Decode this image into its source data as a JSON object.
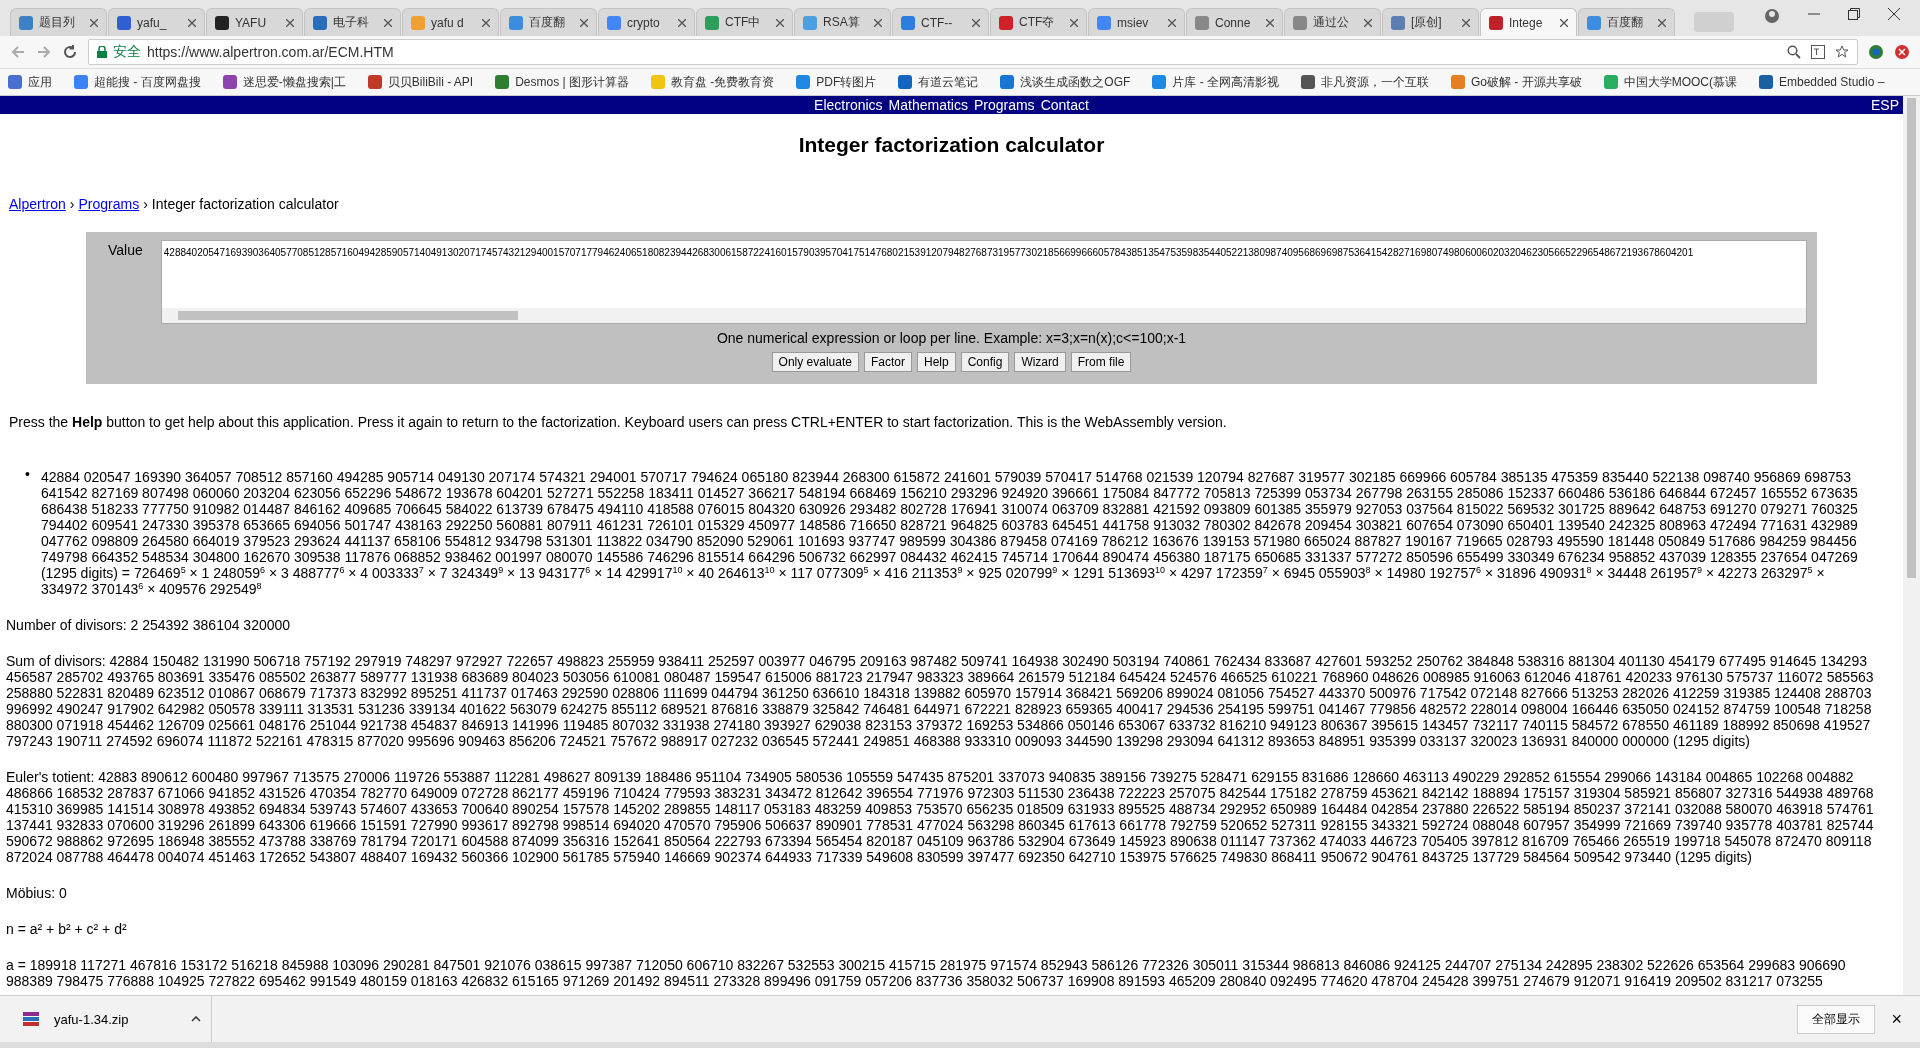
{
  "browser": {
    "tabs": [
      {
        "label": "题目列",
        "selected": false,
        "color": "#3b82c4"
      },
      {
        "label": "yafu_",
        "selected": false,
        "color": "#2f5fd0"
      },
      {
        "label": "YAFU",
        "selected": false,
        "color": "#222222"
      },
      {
        "label": "电子科",
        "selected": false,
        "color": "#2a6ebb"
      },
      {
        "label": "yafu d",
        "selected": false,
        "color": "#f0a030"
      },
      {
        "label": "百度翻",
        "selected": false,
        "color": "#3c8dde"
      },
      {
        "label": "crypto",
        "selected": false,
        "color": "#4285f4"
      },
      {
        "label": "CTF中",
        "selected": false,
        "color": "#2e9e5b"
      },
      {
        "label": "RSA算",
        "selected": false,
        "color": "#4aa0e0"
      },
      {
        "label": "CTF--",
        "selected": false,
        "color": "#2d7de0"
      },
      {
        "label": "CTF夺",
        "selected": false,
        "color": "#d0202a"
      },
      {
        "label": "msiev",
        "selected": false,
        "color": "#4285f4"
      },
      {
        "label": "Conne",
        "selected": false,
        "color": "#888888"
      },
      {
        "label": "通过公",
        "selected": false,
        "color": "#888888"
      },
      {
        "label": "[原创]",
        "selected": false,
        "color": "#5b7fb0"
      },
      {
        "label": "Intege",
        "selected": true,
        "color": "#c0202a"
      },
      {
        "label": "百度翻",
        "selected": false,
        "color": "#3c8dde"
      }
    ],
    "secure_label": "安全",
    "url": "https://www.alpertron.com.ar/ECM.HTM",
    "bookmarks": [
      {
        "label": "应用",
        "color": "#4a6fd0"
      },
      {
        "label": "超能搜 - 百度网盘搜",
        "color": "#3b82f6"
      },
      {
        "label": "迷思爱-懒盘搜索|工",
        "color": "#8e44ad"
      },
      {
        "label": "贝贝BiliBili - API",
        "color": "#c0392b"
      },
      {
        "label": "Desmos | 图形计算器",
        "color": "#2e7d32"
      },
      {
        "label": "教育盘 -免费教育资",
        "color": "#f1c40f"
      },
      {
        "label": "PDF转图片",
        "color": "#1e88e5"
      },
      {
        "label": "有道云笔记",
        "color": "#1565c0"
      },
      {
        "label": "浅谈生成函数之OGF",
        "color": "#1976d2"
      },
      {
        "label": "片库 - 全网高清影视",
        "color": "#1e88e5"
      },
      {
        "label": "非凡资源，一个互联",
        "color": "#555555"
      },
      {
        "label": "Go破解 - 开源共享破",
        "color": "#e67e22"
      },
      {
        "label": "中国大学MOOC(慕课",
        "color": "#27ae60"
      },
      {
        "label": "Embedded Studio –",
        "color": "#1a5fa0"
      }
    ]
  },
  "nav": {
    "links": [
      "Electronics",
      "Mathematics",
      "Programs",
      "Contact"
    ],
    "language": "ESP"
  },
  "title": "Integer factorization calculator",
  "breadcrumb": {
    "links": [
      "Alpertron",
      "Programs"
    ],
    "separator": "›",
    "current": "Integer factorization calculator"
  },
  "list_marker": "•",
  "calculator": {
    "value_label": "Value",
    "value": "42884020547169390364057708512857160494285905714049130207174574321294001570717794624065180823944268300615872241601579039570417514768021539120794827687319577302185669966605784385135475359835440522138098740956869698753641542827169807498060060203204623056652296548672193678604201",
    "hint": "One numerical expression or loop per line. Example: x=3;x=n(x);c<=100;x-1",
    "buttons": [
      "Only evaluate",
      "Factor",
      "Help",
      "Config",
      "Wizard",
      "From file"
    ]
  },
  "help_text": "Press the **Help** button to get help about this application. Press it again to return to the factorization. Keyboard users can press CTRL+ENTER to start factorization. This is the WebAssembly version.",
  "factorization": "42884 020547 169390 364057 708512 857160 494285 905714 049130 207174 574321 294001 570717 794624 065180 823944 268300 615872 241601 579039 570417 514768 021539 120794 827687 319577 302185 669966 605784 385135 475359 835440 522138 098740 956869 698753 641542 827169 807498 060060 203204 623056 652296 548672 193678 604201 527271 552258 183411 014527 366217 548194 668469 156210 293296 924920 396661 175084 847772 705813 725399 053734 267798 263155 285086 152337 660486 536186 646844 672457 165552 673635 686438 518233 777750 910982 014487 846162 409685 706645 584022 613739 678475 494110 418588 076015 804320 630926 293482 802728 176941 310074 063709 832881 421592 093809 601385 355979 927053 037564 815022 569532 301725 889642 648753 691270 079271 760325 794402 609541 247330 395378 653665 694056 501747 438163 292250 560881 807911 461231 726101 015329 450977 148586 716650 828721 964825 603783 645451 441758 913032 780302 842678 209454 303821 607654 073090 650401 139540 242325 808963 472494 771631 432989 047762 098809 264580 664019 379523 293624 441137 658106 554812 934798 531301 113822 034790 852090 529061 101693 937747 989599 304386 879458 074169 786212 163676 139153 571980 665024 887827 190167 719665 028793 495590 181448 050849 517686 984259 984456 749798 664352 548534 304800 162670 309538 117876 068852 938462 001997 080070 145586 746296 815514 664296 506732 662997 084432 462415 745714 170644 890474 456380 187175 650685 331337 577272 850596 655499 330349 676234 958852 437039 128355 237654 047269 (1295 digits) = 726469$^{5}$ × 1 248059$^{6}$ × 3 488777$^{6}$ × 4 003333$^{7}$ × 7 324349$^{9}$ × 13 943177$^{6}$ × 14 429917$^{10}$ × 40 264613$^{10}$ × 117 077309$^{5}$ × 416 211353$^{9}$ × 925 020799$^{9}$ × 1291 513693$^{10}$ × 4297 172359$^{7}$ × 6945 055903$^{8}$ × 14980 192757$^{6}$ × 31896 490931$^{8}$ × 34448 261957$^{9}$ × 42273 263297$^{5}$ × 334972 370143$^{6}$ × 409576 292549$^{8}$",
  "results": [
    {
      "label": "Number of divisors:",
      "value": "2 254392 386104 320000"
    },
    {
      "label": "Sum of divisors:",
      "value": "42884 150482 131990 506718 757192 297919 748297 972927 722657 498823 255959 938411 252597 003977 046795 209163 987482 509741 164938 302490 503194 740861 762434 833687 427601 593252 250762 384848 538316 881304 401130 454179 677495 914645 134293 456587 285702 493765 803691 335476 085502 263877 589777 131938 683689 804023 503056 610081 080487 159547 615006 881723 217947 983323 389664 261579 512184 645424 524576 466525 610221 768960 048626 008985 916063 612046 418761 420233 976130 575737 116072 585563 258880 522831 820489 623512 010867 068679 717373 832992 895251 411737 017463 292590 028806 111699 044794 361250 636610 184318 139882 605970 157914 368421 569206 899024 081056 754527 443370 500976 717542 072148 827666 513253 282026 412259 319385 124408 288703 996992 490247 917902 642982 050578 339111 313531 531236 339134 401622 563079 624275 855112 689521 876816 338879 325842 746481 644971 672221 828923 659365 400417 294536 254195 599751 041467 779856 482572 228014 098004 166446 635050 024152 874759 100548 718258 880300 071918 454462 126709 025661 048176 251044 921738 454837 846913 141996 119485 807032 331938 274180 393927 629038 823153 379372 169253 534866 050146 653067 633732 816210 949123 806367 395615 143457 732117 740115 584572 678550 461189 188992 850698 419527 797243 190711 274592 696074 111872 522161 478315 877020 995696 909463 856206 724521 757672 988917 027232 036545 572441 249851 468388 933310 009093 344590 139298 293094 641312 893653 848951 935399 033137 320023 136931 840000 000000 (1295 digits)"
    },
    {
      "label": "Euler's totient:",
      "value": "42883 890612 600480 997967 713575 270006 119726 553887 112281 498627 809139 188486 951104 734905 580536 105559 547435 875201 337073 940835 389156 739275 528471 629155 831686 128660 463113 490229 292852 615554 299066 143184 004865 102268 004882 486866 168532 287837 671066 941852 431526 470354 782770 649009 072728 862177 459196 710424 779593 383231 343472 812642 396554 771976 972303 511530 236438 722223 257075 842544 175182 278759 453621 842142 188894 175157 319304 585921 856807 327316 544938 489768 415310 369985 141514 308978 493852 694834 539743 574607 433653 700640 890254 157578 145202 289855 148117 053183 483259 409853 753570 656235 018509 631933 895525 488734 292952 650989 164484 042854 237880 226522 585194 850237 372141 032088 580070 463918 574761 137441 932833 070600 319296 261899 643306 619666 151591 727990 993617 892798 998514 694020 470570 795906 506637 890901 778531 477024 563298 860345 617613 661778 792759 520652 527311 928155 343321 592724 088048 607957 354999 721669 739740 935778 403781 825744 590672 988862 972695 186948 385552 473788 338769 781794 720171 604588 874099 356316 152641 850564 222793 673394 565454 820187 045109 963786 532904 673649 145923 890638 011147 737362 474033 446723 705405 397812 816709 765466 265519 199718 545078 872470 809118 872024 087788 464478 004074 451463 172652 543807 488407 169432 560366 102900 561785 575940 146669 902374 644933 717339 549608 830599 397477 692350 642710 153975 576625 749830 868411 950672 904761 843725 137729 584564 509542 973440 (1295 digits)"
    },
    {
      "label": "Möbius:",
      "value": "0"
    },
    {
      "label": "n =",
      "value": "a² + b² + c² + d²"
    },
    {
      "label": "a =",
      "value": "189918 117271 467816 153172 516218 845988 103096 290281 847501 921076 038615 997387 712050 606710 832267 532553 300215 415715 281975 971574 852943 586126 772326 305011 315344 986813 846086 924125 244707 275134 242895 238302 522626 653564 299683 906690 988389 798475 776888 104925 727822 695462 991549 480159 018163 426832 615165 971269 201492 894511 273328 899496 091759 057206 837736 358032 506737 169908 891593 465209 280840 092495 774620 478704 245428 399751 274679 912071 916419 209502 831217 073255"
    }
  ],
  "download": {
    "file": "yafu-1.34.zip",
    "show_all": "全部显示",
    "close": "×"
  }
}
